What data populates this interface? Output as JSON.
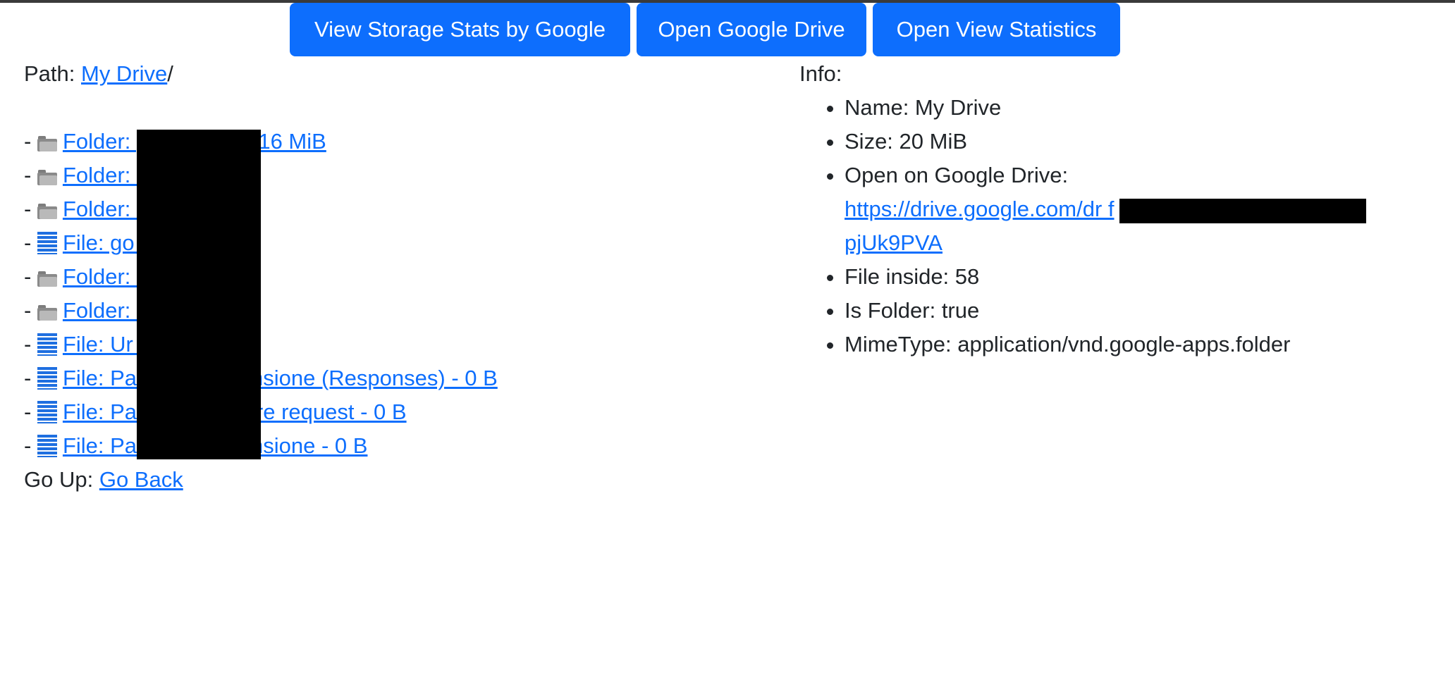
{
  "buttons": {
    "storage_stats": "View Storage Stats by Google",
    "open_drive": "Open Google Drive",
    "view_statistics": "Open View Statistics"
  },
  "path": {
    "label": "Path: ",
    "link": "My Drive",
    "suffix": "/"
  },
  "entries": [
    {
      "kind": "folder",
      "text": "Folder:              ge Images - 16 MiB"
    },
    {
      "kind": "folder",
      "text": "Folder:               3 MiB"
    },
    {
      "kind": "folder",
      "text": "Folder:              - 1.6 MiB"
    },
    {
      "kind": "file",
      "text": "File: go               B"
    },
    {
      "kind": "folder",
      "text": "Folder:               iB"
    },
    {
      "kind": "folder",
      "text": "Folder:              - 2.3 KiB"
    },
    {
      "kind": "file",
      "text": "File: Ur               - 0 B"
    },
    {
      "kind": "file",
      "text": "File: Pa               App - Recensione (Responses) - 0 B"
    },
    {
      "kind": "file",
      "text": "File: Pa               App - Feature request - 0 B"
    },
    {
      "kind": "file",
      "text": "File: Pa               App - Recensione - 0 B"
    }
  ],
  "goup": {
    "label": "Go Up: ",
    "link": "Go Back"
  },
  "info": {
    "title": "Info:",
    "name": "Name: My Drive",
    "size": "Size: 20 MiB",
    "open_label": "Open on Google Drive:",
    "url_line1": "https://drive.google.com/dr                          f",
    "url_line2": "pjUk9PVA",
    "files_inside": "File inside: 58",
    "is_folder": "Is Folder: true",
    "mimetype": "MimeType: application/vnd.google-apps.folder"
  },
  "colors": {
    "primary": "#0d6efd",
    "link": "#0d6efd",
    "text": "#212529",
    "redaction": "#000000"
  }
}
